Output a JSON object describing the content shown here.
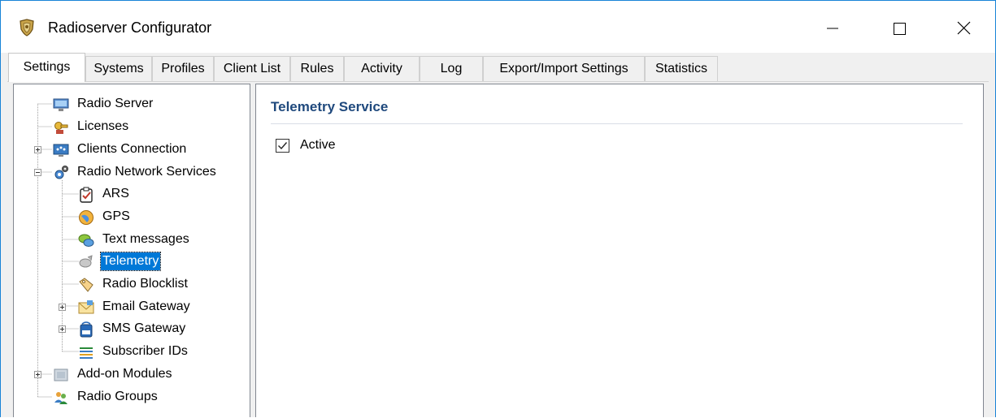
{
  "window": {
    "title": "Radioserver Configurator"
  },
  "tabs": [
    {
      "label": "Settings"
    },
    {
      "label": "Systems"
    },
    {
      "label": "Profiles"
    },
    {
      "label": "Client List"
    },
    {
      "label": "Rules"
    },
    {
      "label": "Activity"
    },
    {
      "label": "Log"
    },
    {
      "label": "Export/Import Settings"
    },
    {
      "label": "Statistics"
    }
  ],
  "active_tab": "Settings",
  "tree": {
    "radio_server": "Radio Server",
    "licenses": "Licenses",
    "clients_connection": "Clients Connection",
    "radio_network_services": "Radio Network Services",
    "ars": "ARS",
    "gps": "GPS",
    "text_messages": "Text messages",
    "telemetry": "Telemetry",
    "radio_blocklist": "Radio Blocklist",
    "email_gateway": "Email Gateway",
    "sms_gateway": "SMS Gateway",
    "subscriber_ids": "Subscriber IDs",
    "addon_modules": "Add-on Modules",
    "radio_groups": "Radio Groups",
    "selected": "Telemetry"
  },
  "content": {
    "section_title": "Telemetry Service",
    "active_label": "Active",
    "active_checked": true
  },
  "icons": {
    "app": "app-shield-icon",
    "minimize": "minimize-icon",
    "maximize": "maximize-icon",
    "close": "close-icon"
  },
  "colors": {
    "selection": "#0078d7",
    "section_title": "#1f497d",
    "window_border": "#1883d7"
  }
}
